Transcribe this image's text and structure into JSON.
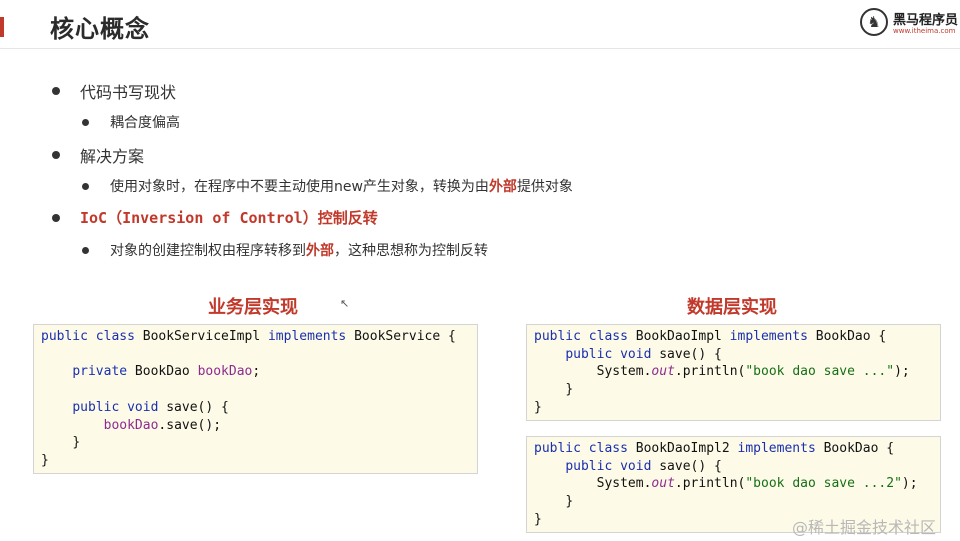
{
  "header": {
    "title": "核心概念"
  },
  "logo": {
    "name": "黑马程序员",
    "url": "www.itheima.com"
  },
  "bullets": {
    "b1": "代码书写现状",
    "b1_sub": "耦合度偏高",
    "b2": "解决方案",
    "b2_sub_pre": "使用对象时，在程序中不要主动使用new产生对象，转换为由",
    "b2_sub_red": "外部",
    "b2_sub_post": "提供对象",
    "b3_red": "IoC（Inversion of Control）控制反转",
    "b3_sub_pre": "对象的创建控制权由程序转移到",
    "b3_sub_red": "外部",
    "b3_sub_post": "，这种思想称为控制反转"
  },
  "sections": {
    "business": "业务层实现",
    "data": "数据层实现"
  },
  "code": {
    "service": {
      "l1_kw": "public class",
      "l1_name": " BookServiceImpl ",
      "l1_kw2": "implements",
      "l1_tail": " BookService {",
      "l3_kw": "private",
      "l3_type": " BookDao ",
      "l3_field": "bookDao",
      "l3_tail": ";",
      "l5_kw": "public void",
      "l5_tail": " save() {",
      "l6_field": "bookDao",
      "l6_tail": ".save();",
      "l7": "}",
      "l8": "}"
    },
    "dao1": {
      "l1_kw": "public class",
      "l1_name": " BookDaoImpl ",
      "l1_kw2": "implements",
      "l1_tail": " BookDao {",
      "l2_kw": "public void",
      "l2_tail": " save() {",
      "l3_pre": "System.",
      "l3_out": "out",
      "l3_mid": ".println(",
      "l3_str": "\"book dao save ...\"",
      "l3_tail": ");",
      "l4": "}",
      "l5": "}"
    },
    "dao2": {
      "l1_kw": "public class",
      "l1_name": " BookDaoImpl2 ",
      "l1_kw2": "implements",
      "l1_tail": " BookDao {",
      "l2_kw": "public void",
      "l2_tail": " save() {",
      "l3_pre": "System.",
      "l3_out": "out",
      "l3_mid": ".println(",
      "l3_str": "\"book dao save ...2\"",
      "l3_tail": ");",
      "l4": "}",
      "l5": "}"
    }
  },
  "watermark": "@稀土掘金技术社区",
  "colors": {
    "accent": "#c0392b",
    "code_bg": "#fdfbe8",
    "keyword": "#1a2fb0",
    "field": "#8f2a8f",
    "string": "#167016"
  }
}
